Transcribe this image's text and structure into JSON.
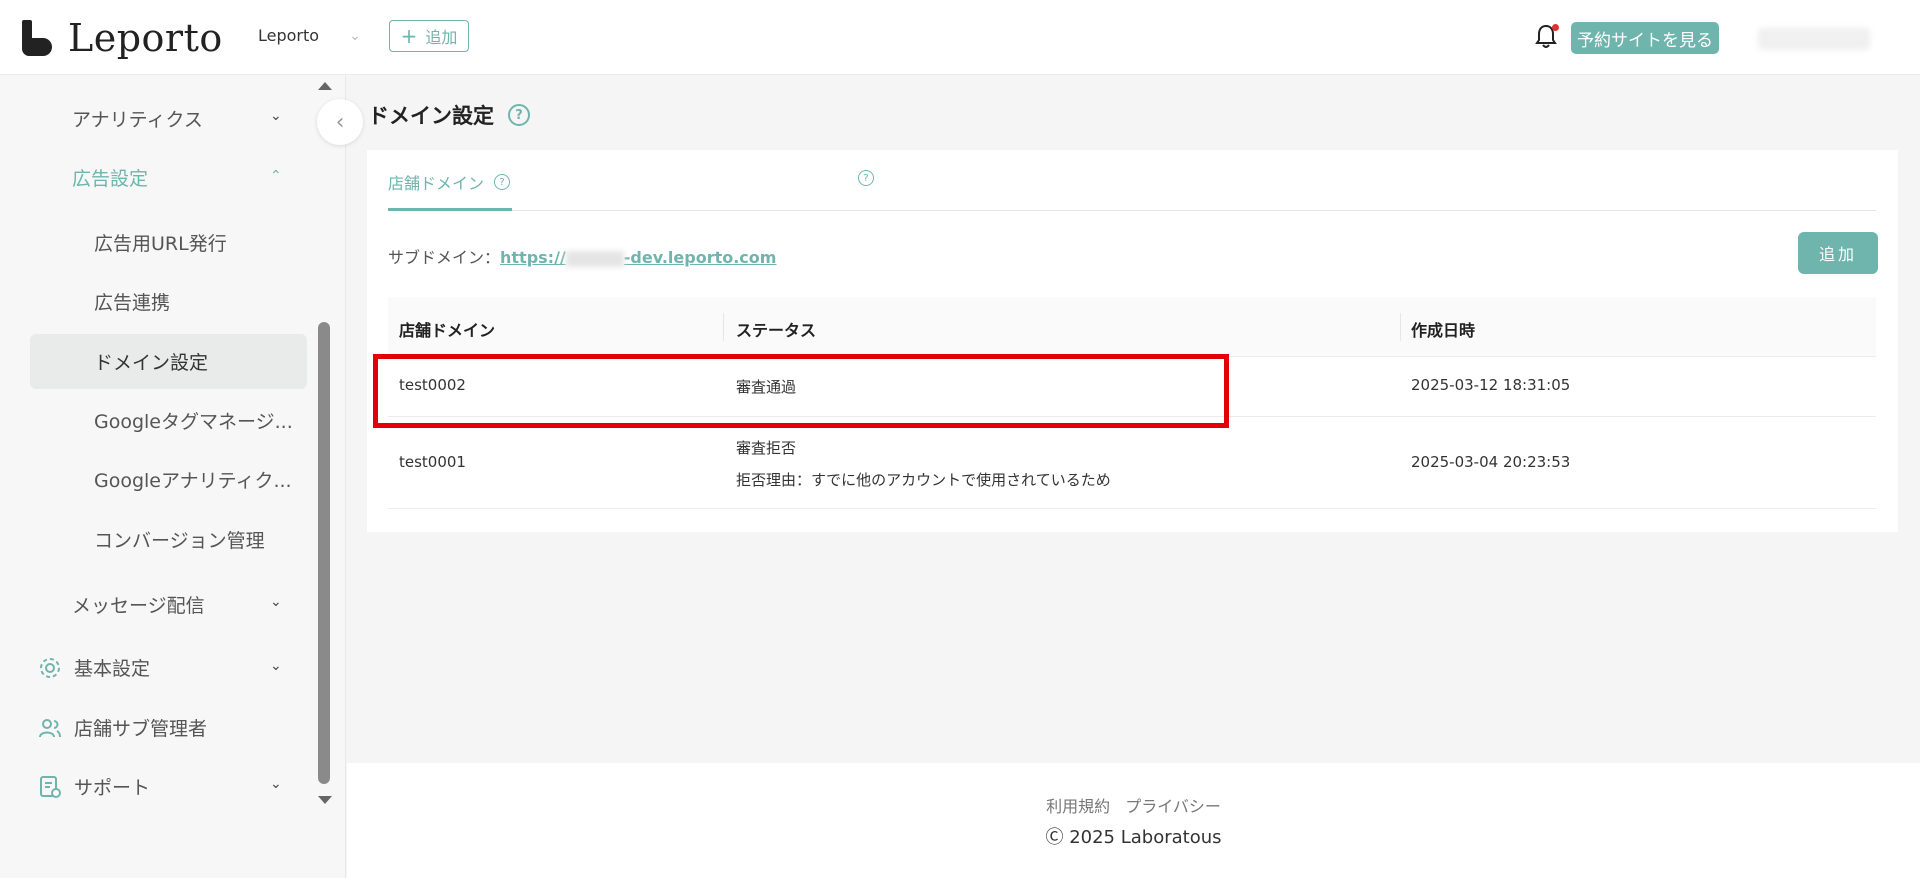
{
  "header": {
    "logo_text": "Leporto",
    "store_select": "Leporto",
    "add_label": "追加",
    "view_site_label": "予約サイトを見る"
  },
  "sidebar": {
    "items": [
      {
        "label": "アナリティクス",
        "chevron": "down"
      },
      {
        "label": "広告設定",
        "chevron": "up"
      },
      {
        "label": "広告用URL発行"
      },
      {
        "label": "広告連携"
      },
      {
        "label": "ドメイン設定"
      },
      {
        "label": "Googleタグマネージ..."
      },
      {
        "label": "Googleアナリティク..."
      },
      {
        "label": "コンバージョン管理"
      },
      {
        "label": "メッセージ配信",
        "chevron": "down"
      },
      {
        "label": "基本設定",
        "icon": "gear-icon",
        "chevron": "down"
      },
      {
        "label": "店舗サブ管理者",
        "icon": "users-icon"
      },
      {
        "label": "サポート",
        "icon": "support-icon",
        "chevron": "down"
      }
    ]
  },
  "main": {
    "title": "ドメイン設定",
    "tabs": [
      {
        "label": "店舗ドメイン",
        "active": true
      },
      {
        "label": "",
        "active": false
      }
    ],
    "subdomain_label": "サブドメイン：",
    "subdomain_prefix": "https://",
    "subdomain_suffix": "-dev.leporto.com",
    "add_button": "追加",
    "table": {
      "headers": [
        "店舗ドメイン",
        "ステータス",
        "作成日時"
      ],
      "rows": [
        {
          "domain": "test0002",
          "status": "審査通過",
          "reason": "",
          "created": "2025-03-12 18:31:05"
        },
        {
          "domain": "test0001",
          "status": "審査拒否",
          "reason": "拒否理由：すでに他のアカウントで使用されているため",
          "created": "2025-03-04 20:23:53"
        }
      ]
    }
  },
  "footer": {
    "terms": "利用規約",
    "privacy": "プライバシー",
    "copyright": "2025 Laboratous"
  },
  "colors": {
    "accent": "#6fb5ad",
    "highlight": "#e3000b",
    "notification_dot": "#e03030"
  }
}
